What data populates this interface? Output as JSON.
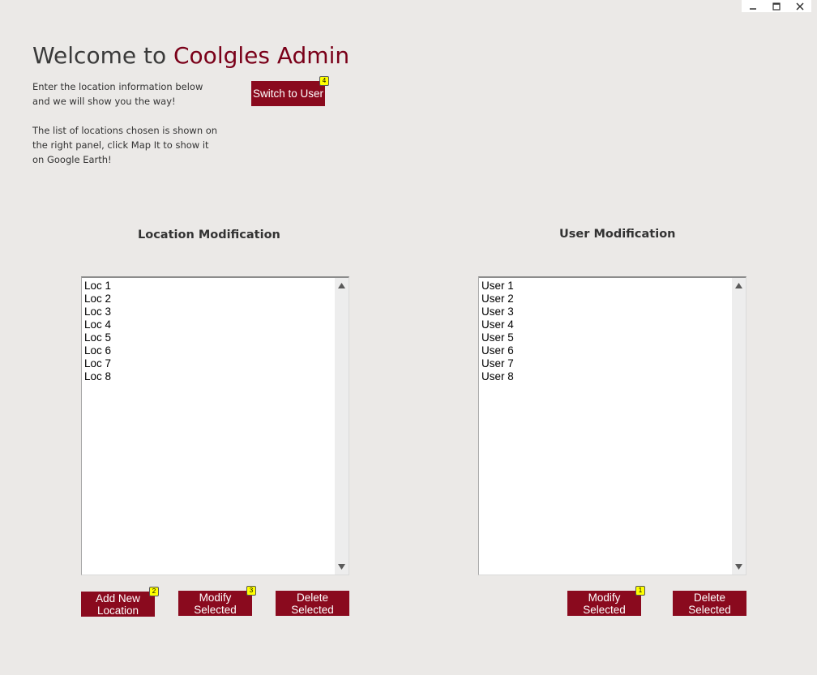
{
  "window": {
    "minimize_icon": "minimize-icon",
    "maximize_icon": "maximize-icon",
    "close_icon": "close-icon"
  },
  "header": {
    "title_prefix": "Welcome to ",
    "title_brand": "Coolgles Admin",
    "intro_line_1": "Enter the location information below and we will show you the way!",
    "intro_line_2": "The list of locations chosen is shown on the right panel, click Map It to show it on Google Earth!",
    "switch_button": {
      "label": "Switch to User",
      "badge": "4"
    }
  },
  "locations": {
    "title": "Location Modification",
    "items": [
      "Loc 1",
      "Loc 2",
      "Loc 3",
      "Loc 4",
      "Loc 5",
      "Loc 6",
      "Loc 7",
      "Loc 8"
    ],
    "add_button": {
      "label": "Add New\nLocation",
      "badge": "2"
    },
    "modify_button": {
      "label": "Modify\nSelected",
      "badge": "3"
    },
    "delete_button": {
      "label": "Delete\nSelected"
    }
  },
  "users": {
    "title": "User Modification",
    "items": [
      "User 1",
      "User 2",
      "User 3",
      "User 4",
      "User 5",
      "User 6",
      "User 7",
      "User 8"
    ],
    "modify_button": {
      "label": "Modify\nSelected",
      "badge": "1"
    },
    "delete_button": {
      "label": "Delete\nSelected"
    }
  },
  "colors": {
    "background": "#ebe9e7",
    "brand": "#7a0019",
    "button": "#8a0a1e",
    "badge": "#ffff00"
  }
}
